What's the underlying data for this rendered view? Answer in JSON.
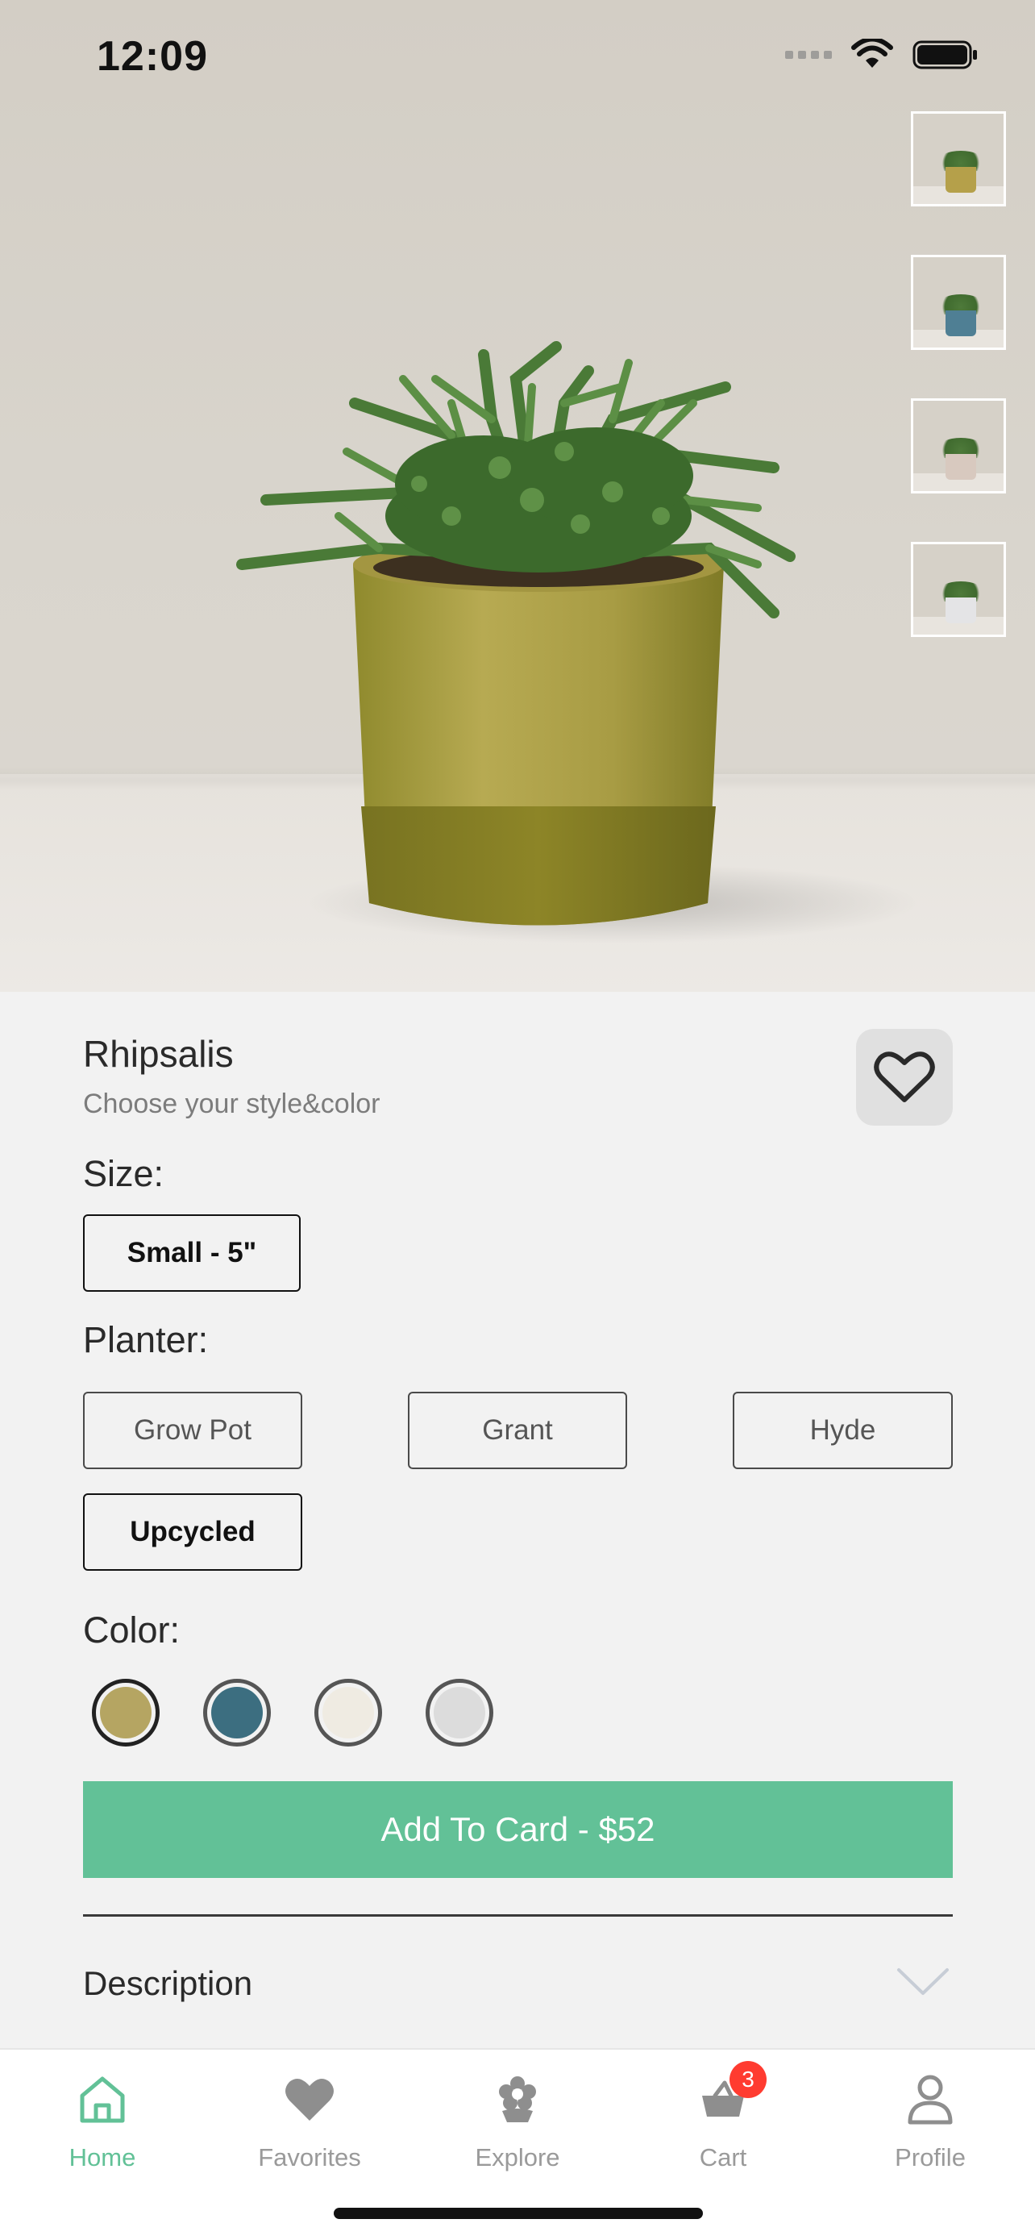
{
  "status_bar": {
    "time": "12:09"
  },
  "product": {
    "name": "Rhipsalis",
    "subtitle": "Choose your style&color",
    "thumbnails": [
      {
        "pot_color": "#b5a04a"
      },
      {
        "pot_color": "#4f7f94"
      },
      {
        "pot_color": "#d8c9bf"
      },
      {
        "pot_color": "#e4e4e6"
      }
    ]
  },
  "size": {
    "label": "Size:",
    "options": [
      {
        "label": "Small - 5\"",
        "selected": true
      }
    ]
  },
  "planter": {
    "label": "Planter:",
    "options": [
      {
        "label": "Grow Pot",
        "selected": false
      },
      {
        "label": "Grant",
        "selected": false
      },
      {
        "label": "Hyde",
        "selected": false
      },
      {
        "label": "Upcycled",
        "selected": true
      }
    ]
  },
  "color": {
    "label": "Color:",
    "swatches": [
      {
        "name": "olive",
        "hex": "#b5a562",
        "selected": true
      },
      {
        "name": "teal",
        "hex": "#3c6e80",
        "selected": false
      },
      {
        "name": "cream",
        "hex": "#efebe2",
        "selected": false
      },
      {
        "name": "light-gray",
        "hex": "#dcdcdc",
        "selected": false
      }
    ]
  },
  "cta": {
    "label": "Add To Card - $52",
    "color": "#62c197"
  },
  "description": {
    "label": "Description"
  },
  "tabbar": {
    "tabs": [
      {
        "label": "Home",
        "icon": "home-icon",
        "active": true
      },
      {
        "label": "Favorites",
        "icon": "heart-icon",
        "active": false
      },
      {
        "label": "Explore",
        "icon": "flower-icon",
        "active": false
      },
      {
        "label": "Cart",
        "icon": "basket-icon",
        "active": false,
        "badge": "3"
      },
      {
        "label": "Profile",
        "icon": "person-icon",
        "active": false
      }
    ]
  }
}
